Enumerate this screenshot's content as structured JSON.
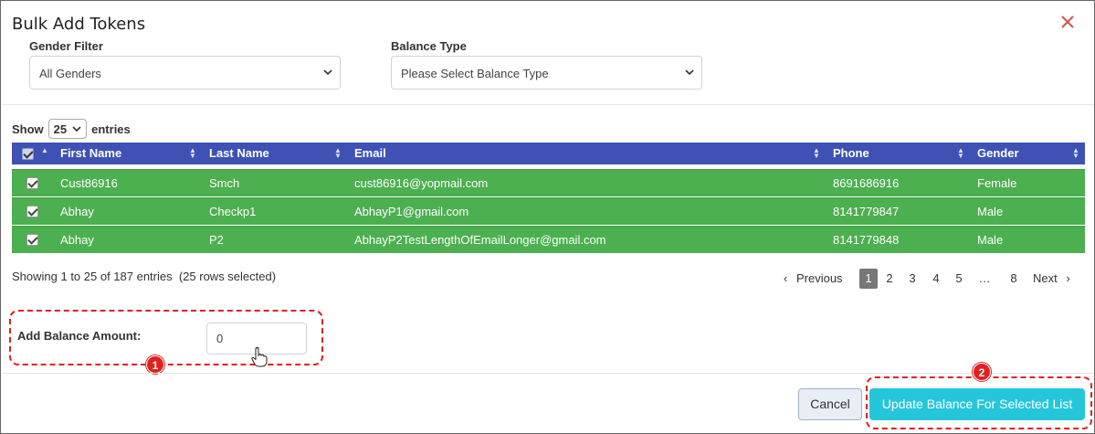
{
  "dialog": {
    "title": "Bulk Add Tokens",
    "close_icon": "close-icon"
  },
  "filters": {
    "gender_label": "Gender Filter",
    "gender_value": "All Genders",
    "balance_type_label": "Balance Type",
    "balance_type_value": "Please Select Balance Type"
  },
  "length": {
    "show": "Show",
    "value": "25",
    "entries": "entries"
  },
  "table": {
    "headers": [
      "First Name",
      "Last Name",
      "Email",
      "Phone",
      "Gender"
    ],
    "rows": [
      {
        "first": "Cust86916",
        "last": "Smch",
        "email": "cust86916@yopmail.com",
        "phone": "8691686916",
        "gender": "Female"
      },
      {
        "first": "Abhay",
        "last": "Checkp1",
        "email": "AbhayP1@gmail.com",
        "phone": "8141779847",
        "gender": "Male"
      },
      {
        "first": "Abhay",
        "last": "P2",
        "email": "AbhayP2TestLengthOfEmailLonger@gmail.com",
        "phone": "8141779848",
        "gender": "Male"
      }
    ],
    "row_color": "#4caf50",
    "header_color": "#3f51b5"
  },
  "info": "Showing 1 to 25 of 187 entries  (25 rows selected)",
  "pagination": {
    "previous": "Previous",
    "pages": [
      "1",
      "2",
      "3",
      "4",
      "5",
      "…",
      "8"
    ],
    "next": "Next"
  },
  "amount": {
    "label": "Add Balance Amount:",
    "value": "0"
  },
  "annotations": {
    "badge1": "1",
    "badge2": "2"
  },
  "buttons": {
    "cancel": "Cancel",
    "update": "Update Balance For Selected List"
  }
}
